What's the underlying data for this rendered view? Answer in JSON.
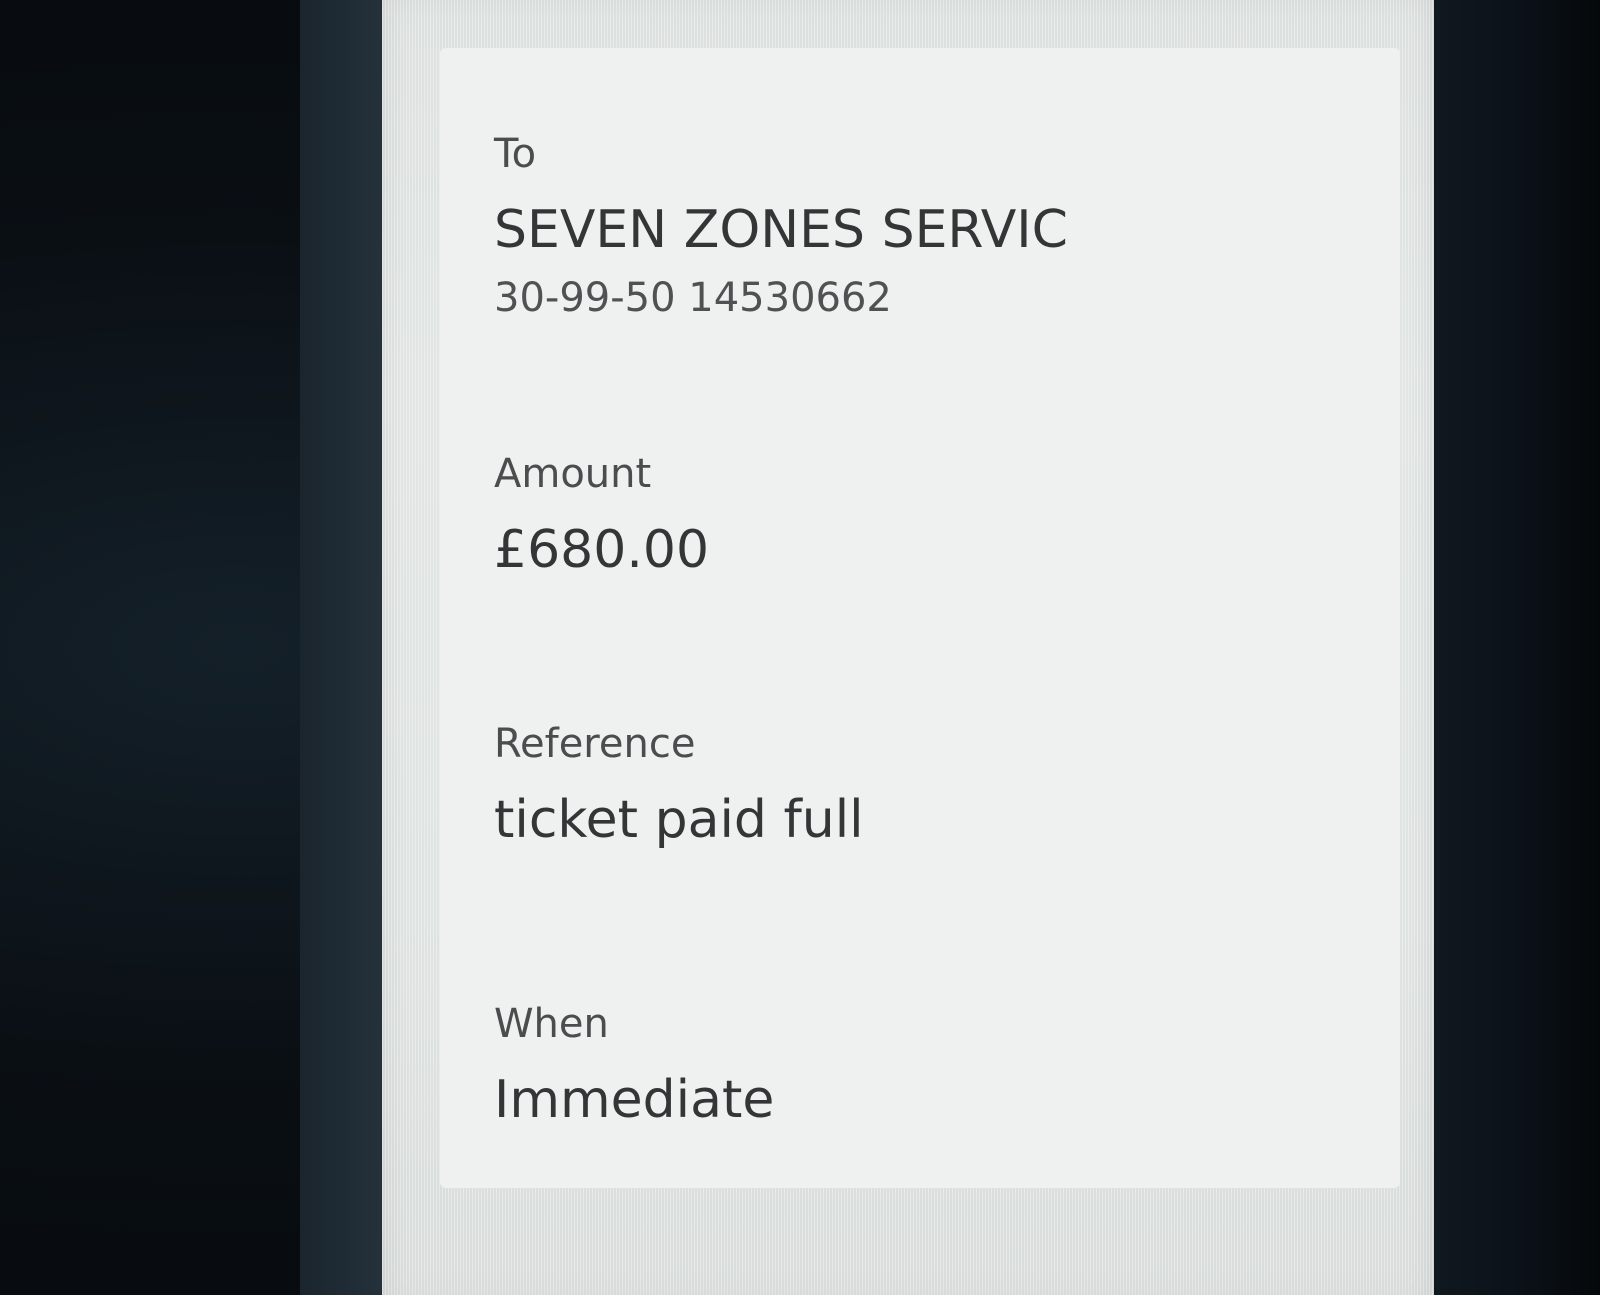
{
  "payment": {
    "to": {
      "label": "To",
      "payee": "SEVEN ZONES SERVIC",
      "account": "30-99-50 14530662"
    },
    "amount": {
      "label": "Amount",
      "value": "£680.00"
    },
    "reference": {
      "label": "Reference",
      "value": "ticket paid full"
    },
    "when": {
      "label": "When",
      "value": "Immediate"
    }
  }
}
